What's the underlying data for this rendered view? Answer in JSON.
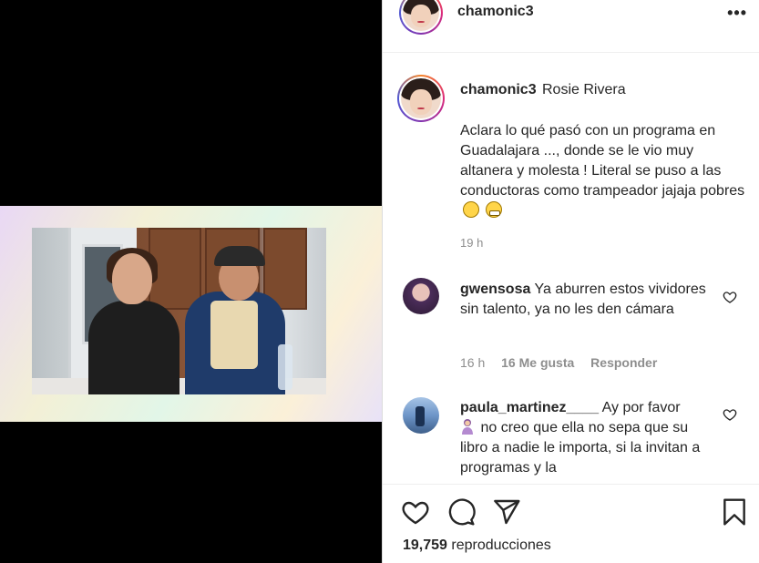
{
  "header": {
    "username": "chamonic3",
    "more_label": "•••"
  },
  "caption": {
    "username": "chamonic3",
    "tag": "Rosie Rivera",
    "text": "Aclara lo qué pasó con un programa en Guadalajara ..., donde se le vio muy altanera y molesta ! Literal se puso a las conductoras como trampeador jajaja pobres",
    "emojis": [
      "slightly-frowning-face",
      "grimacing-face"
    ],
    "time": "19 h"
  },
  "comments": [
    {
      "username": "gwensosa",
      "text": "Ya aburren estos vividores sin talento, ya no les den cámara",
      "time": "16 h",
      "likes": "16 Me gusta",
      "reply": "Responder"
    },
    {
      "username": "paula_martinez____",
      "text_line1": "Ay por favor",
      "text_rest": "no creo que ella no sepa que su libro a nadie le importa, si la invitan a programas y la",
      "emoji": "woman-tipping-hand"
    }
  ],
  "actions": {
    "icons": [
      "heart-icon",
      "comment-icon",
      "share-icon",
      "bookmark-icon"
    ],
    "views_count": "19,759",
    "views_label": "reproducciones"
  },
  "colors": {
    "text": "#262626",
    "muted": "#8e8e8e",
    "border": "#dbdbdb"
  }
}
